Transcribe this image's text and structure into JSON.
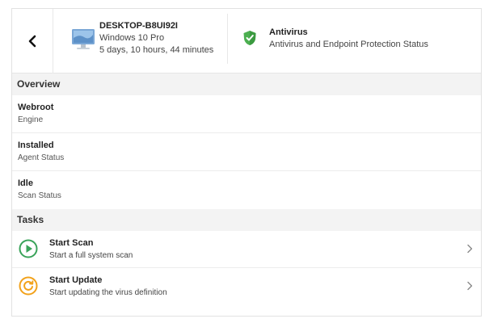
{
  "header": {
    "back_icon": "chevron-left-icon",
    "device": {
      "icon": "monitor-icon",
      "name": "DESKTOP-B8UI92I",
      "os": "Windows 10 Pro",
      "uptime": "5 days, 10 hours, 44 minutes"
    },
    "antivirus": {
      "icon": "shield-check-icon",
      "title": "Antivirus",
      "subtitle": "Antivirus and Endpoint Protection Status"
    }
  },
  "overview": {
    "title": "Overview",
    "items": [
      {
        "value": "Webroot",
        "label": "Engine"
      },
      {
        "value": "Installed",
        "label": "Agent Status"
      },
      {
        "value": "Idle",
        "label": "Scan Status"
      }
    ]
  },
  "tasks": {
    "title": "Tasks",
    "items": [
      {
        "icon": "play-icon",
        "title": "Start Scan",
        "description": "Start a full system scan"
      },
      {
        "icon": "refresh-icon",
        "title": "Start Update",
        "description": "Start updating the virus definition"
      }
    ]
  },
  "colors": {
    "play_green": "#3aa35a",
    "update_orange": "#f2a21b",
    "shield_green": "#4caf50",
    "section_bg": "#f3f3f3"
  }
}
